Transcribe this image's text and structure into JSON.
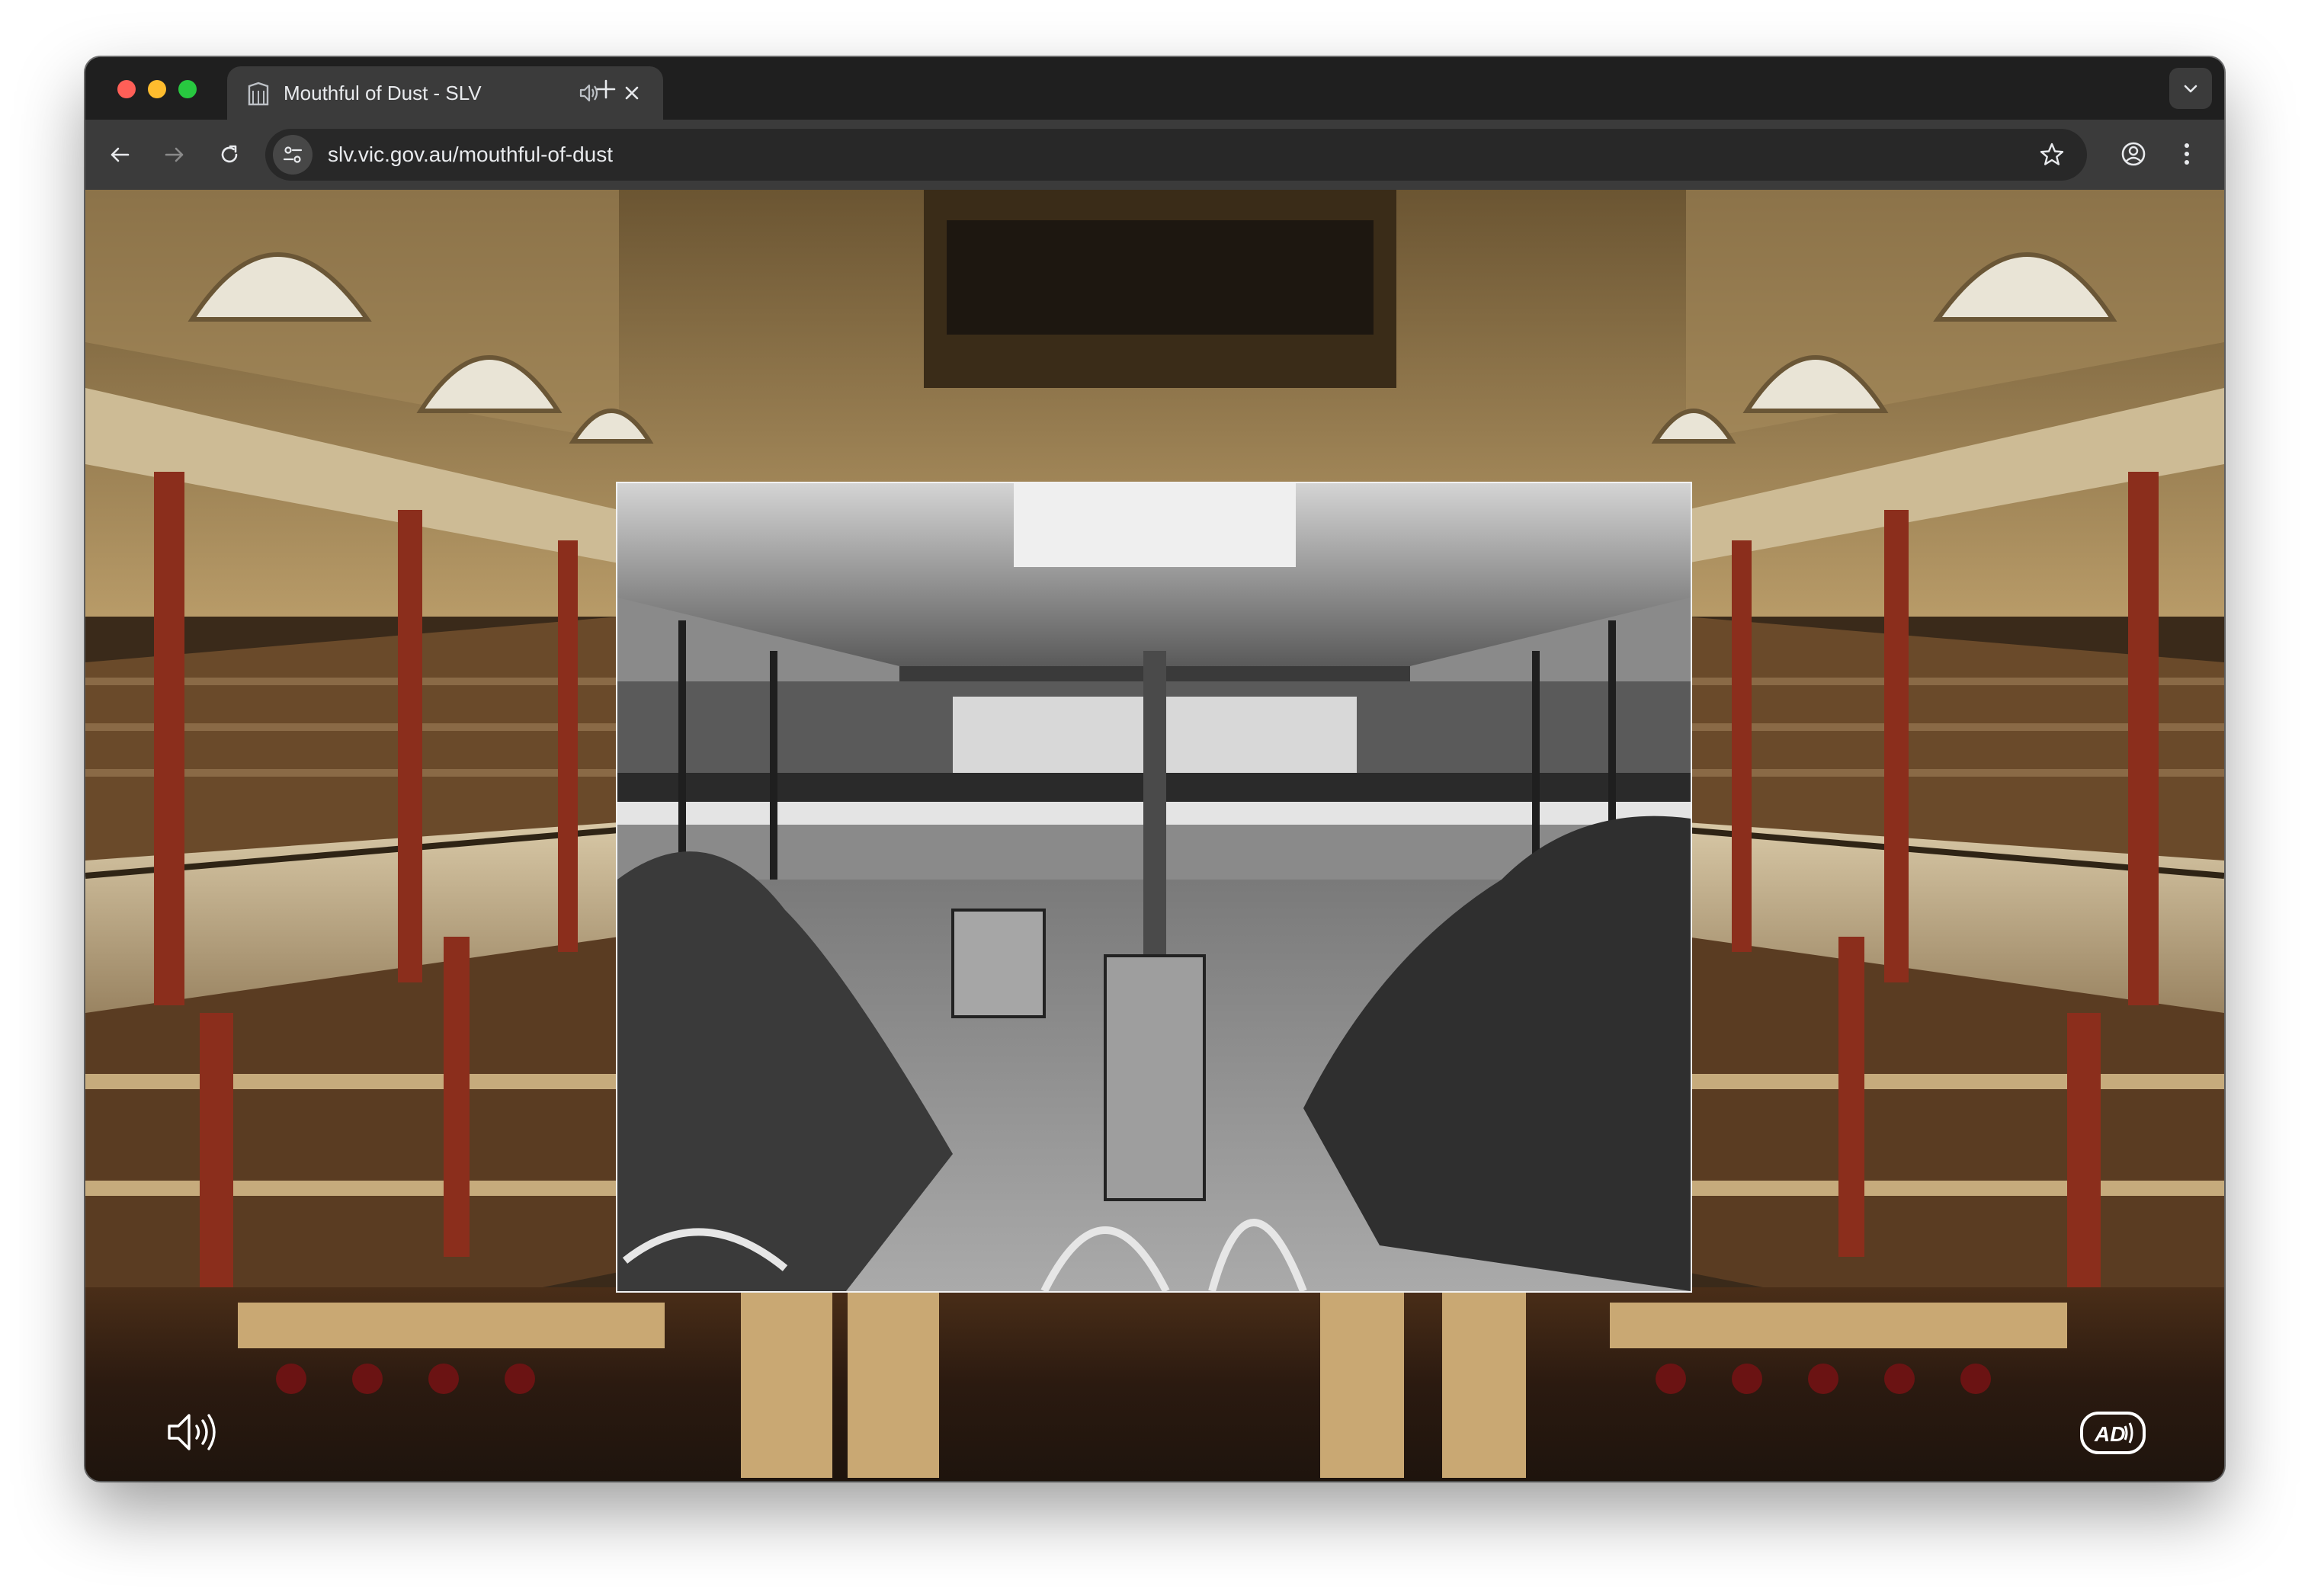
{
  "browser": {
    "tab": {
      "title": "Mouthful of Dust - SLV",
      "favicon": "library-building-icon",
      "audio_playing": true
    },
    "url": {
      "host": "slv.vic.gov.au",
      "path": "/mouthful-of-dust"
    },
    "icons": {
      "back": "back-arrow-icon",
      "forward": "forward-arrow-icon",
      "reload": "reload-icon",
      "site_info": "tune-icon",
      "bookmark": "star-icon",
      "profile": "profile-icon",
      "menu": "kebab-menu-icon",
      "new_tab": "plus-icon",
      "tab_search": "chevron-down-icon"
    }
  },
  "page": {
    "background": "State Library Victoria domed reading room with red columns and bookshelves",
    "overlay_photo": "Black and white archival photograph of a museum hall with taxidermy animals and skeletons",
    "controls": {
      "sound": "speaker-icon",
      "audio_description": "AD"
    }
  },
  "colors": {
    "tab_strip": "#1f1f1f",
    "toolbar": "#3b3b3b",
    "omnibox": "#282828",
    "text": "#e8eaed"
  }
}
